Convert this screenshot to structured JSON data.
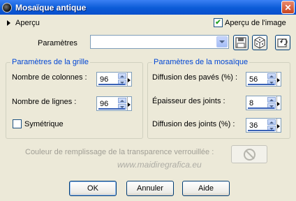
{
  "window": {
    "title": "Mosaïque antique",
    "close_label": "✕"
  },
  "preview": {
    "toggle_label": "Aperçu",
    "image_checkbox_label": "Aperçu de l'image",
    "image_checked": true
  },
  "presets": {
    "label": "Paramètres",
    "selected": ""
  },
  "grid": {
    "title": "Paramètres de la grille",
    "columns_label": "Nombre de colonnes :",
    "columns_value": "96",
    "rows_label": "Nombre de lignes :",
    "rows_value": "96",
    "symmetric_label": "Symétrique",
    "symmetric_checked": false
  },
  "mosaic": {
    "title": "Paramètres de la mosaïque",
    "tile_diffusion_label": "Diffusion des pavés (%) :",
    "tile_diffusion_value": "56",
    "grout_thickness_label": "Épaisseur des joints :",
    "grout_thickness_value": "8",
    "grout_diffusion_label": "Diffusion des joints (%) :",
    "grout_diffusion_value": "36"
  },
  "fill": {
    "label": "Couleur de remplissage de la transparence verrouillée :"
  },
  "watermark": "www.maidiregrafica.eu",
  "buttons": {
    "ok": "OK",
    "cancel": "Annuler",
    "help": "Aide"
  }
}
